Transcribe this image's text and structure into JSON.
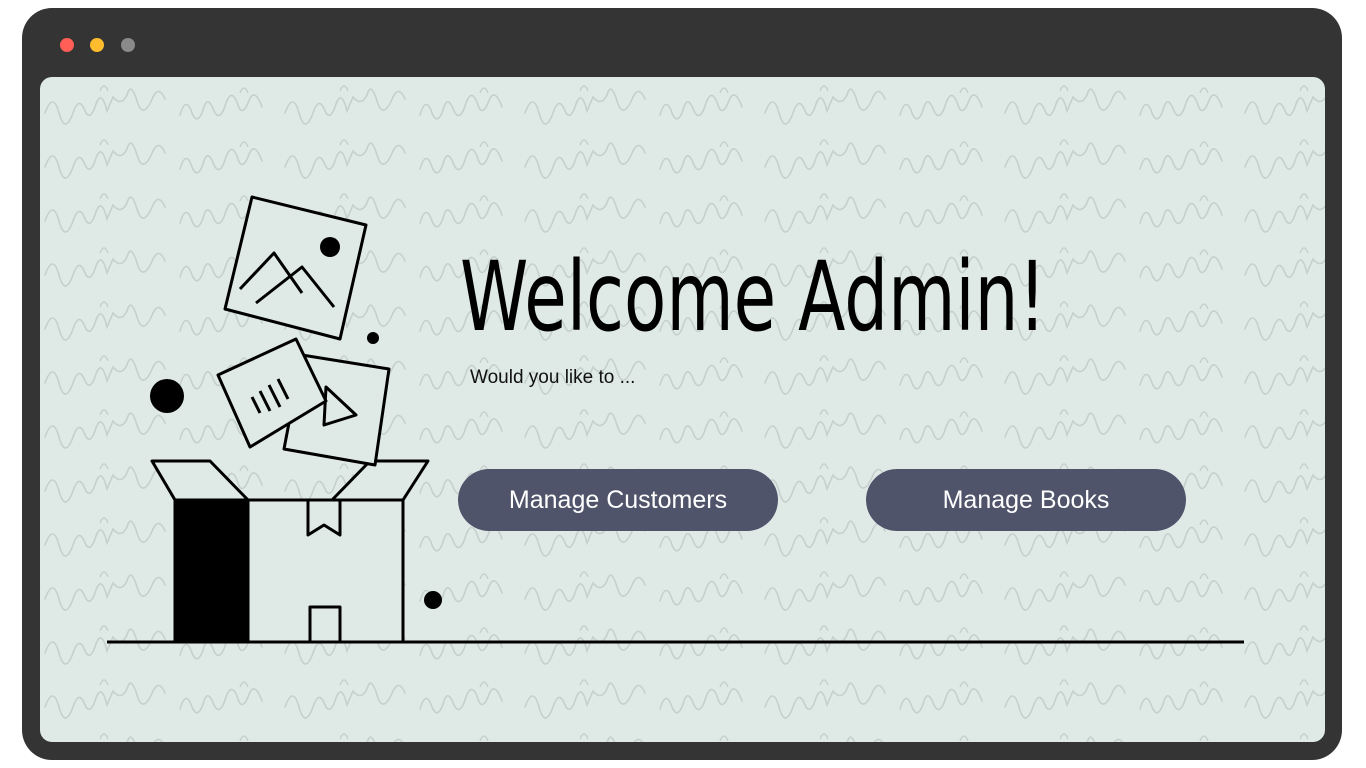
{
  "window": {
    "controls": [
      {
        "name": "close-dot",
        "color": "#ff5f57"
      },
      {
        "name": "minimize-dot",
        "color": "#febc2e"
      },
      {
        "name": "maximize-dot",
        "color": "#8a8a8a"
      }
    ]
  },
  "main": {
    "title": "Welcome Admin!",
    "subtitle": "Would you like to ...",
    "buttons": {
      "manage_customers": "Manage Customers",
      "manage_books": "Manage Books"
    }
  },
  "illustration": {
    "icons": [
      "image-card-icon",
      "audio-card-icon",
      "play-card-icon",
      "open-box-icon"
    ]
  },
  "colors": {
    "frame": "#343434",
    "background": "#dfe9e6",
    "button": "#50546a",
    "button_text": "#ffffff",
    "ink": "#000000"
  }
}
